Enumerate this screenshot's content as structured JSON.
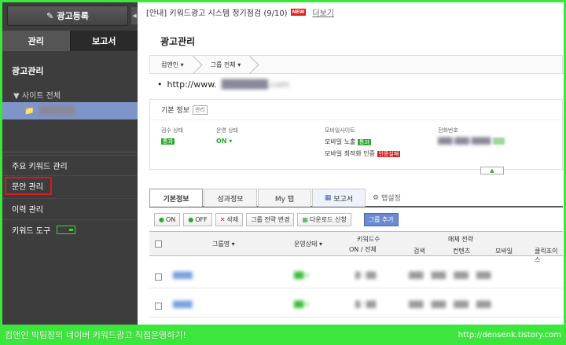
{
  "sidebar": {
    "register_button": "광고등록",
    "tab_manage": "관리",
    "tab_report": "보고서",
    "section_title": "광고관리",
    "site_all": "사이트 전체",
    "menu": {
      "keyword_manage": "주요 키워드 관리",
      "copy_manage": "문안 관리",
      "history_manage": "이력 관리",
      "keyword_tool": "키워드 도구"
    }
  },
  "notice": {
    "text": "[안내] 키워드광고 시스템 정기점검 (9/10)",
    "badge": "NEW",
    "more": "더보기"
  },
  "main": {
    "title": "광고관리",
    "breadcrumbs": [
      "컴앤인",
      "그룹 전체"
    ],
    "url_prefix": "http://www."
  },
  "info": {
    "head": "기본 정보",
    "manage_tag": "관리",
    "review_label": "검수 상태",
    "review_value": "통과",
    "run_label": "운영 상태",
    "run_value": "ON",
    "mobile_label": "모바일사이트",
    "mobile_expose": "모바일 노출",
    "mobile_expose_badge": "통과",
    "mobile_opt": "모바일 최적화 인증",
    "mobile_opt_badge": "인증실패",
    "phone_label": "전화번호"
  },
  "tabs": {
    "basic": "기본정보",
    "perf": "성과정보",
    "mytab": "My 탭",
    "report": "보고서",
    "settings": "탭설정"
  },
  "toolbar": {
    "on": "ON",
    "off": "OFF",
    "delete": "삭제",
    "group_change": "그룹 전략 변경",
    "download": "다운로드 신청",
    "add_group": "그룹 추가"
  },
  "table": {
    "col_group": "그룹명",
    "col_run": "운영상태",
    "col_keyword_count": "키워드수",
    "col_keyword_sub": "ON / 전체",
    "col_media": "매체 전략",
    "col_search": "검색",
    "col_content": "컨텐츠",
    "col_mobile": "모바일",
    "col_click": "클릭초이스"
  },
  "caption": {
    "left": "컴앤인 박팀장의 네이버 키워드광고 직접운영하기!",
    "right": "http://densenk.tistory.com"
  }
}
